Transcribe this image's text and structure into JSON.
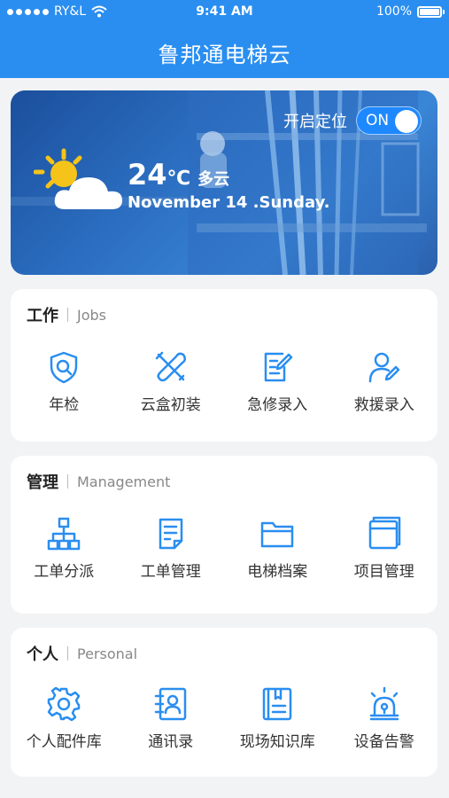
{
  "status_bar": {
    "carrier": "RY&L",
    "time": "9:41 AM",
    "battery": "100%"
  },
  "app": {
    "title": "鲁邦通电梯云"
  },
  "hero": {
    "location_label": "开启定位",
    "toggle_label": "ON",
    "temperature": "24",
    "temp_unit": "℃",
    "condition": "多云",
    "date": "November 14 .Sunday."
  },
  "sections": {
    "jobs": {
      "title": "工作",
      "subtitle": "Jobs",
      "items": [
        {
          "label": "年检",
          "icon": "shield-search-icon"
        },
        {
          "label": "云盒初装",
          "icon": "tools-icon"
        },
        {
          "label": "急修录入",
          "icon": "edit-doc-icon"
        },
        {
          "label": "救援录入",
          "icon": "user-edit-icon"
        }
      ]
    },
    "management": {
      "title": "管理",
      "subtitle": "Management",
      "items": [
        {
          "label": "工单分派",
          "icon": "org-chart-icon"
        },
        {
          "label": "工单管理",
          "icon": "document-icon"
        },
        {
          "label": "电梯档案",
          "icon": "folder-icon"
        },
        {
          "label": "项目管理",
          "icon": "window-icon"
        }
      ]
    },
    "personal": {
      "title": "个人",
      "subtitle": "Personal",
      "items": [
        {
          "label": "个人配件库",
          "icon": "gear-icon"
        },
        {
          "label": "通讯录",
          "icon": "contacts-icon"
        },
        {
          "label": "现场知识库",
          "icon": "book-icon"
        },
        {
          "label": "设备告警",
          "icon": "alarm-icon"
        }
      ]
    }
  },
  "colors": {
    "primary": "#2a8ef0",
    "icon": "#2a8ef0",
    "background": "#f2f3f5"
  }
}
